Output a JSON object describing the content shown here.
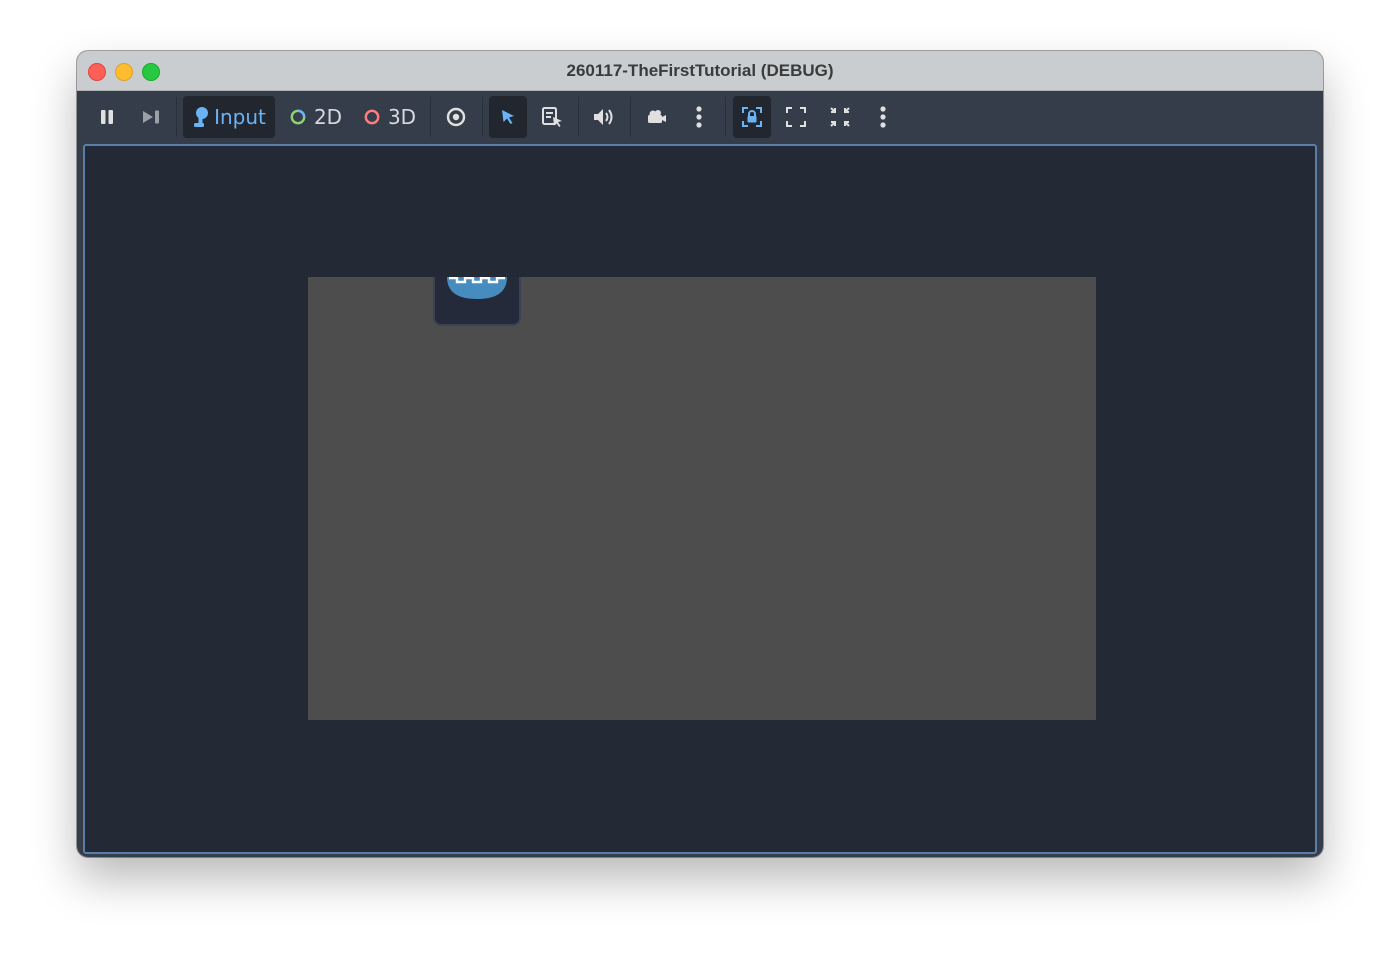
{
  "window": {
    "title": "260117-TheFirstTutorial (DEBUG)"
  },
  "toolbar": {
    "pause_icon": "pause-icon",
    "next_frame_icon": "next-frame-icon",
    "input_label": "Input",
    "mode_2d_label": "2D",
    "mode_3d_label": "3D",
    "visibility_icon": "eye-icon",
    "select_icon": "pointer-select-icon",
    "list_select_icon": "list-select-icon",
    "audio_icon": "speaker-icon",
    "camera_icon": "camera-icon",
    "more_icon": "kebab-menu-icon",
    "camera_lock_icon": "camera-lock-icon",
    "expand_icon": "expand-icon",
    "collapse_icon": "collapse-icon",
    "more2_icon": "kebab-menu-icon"
  },
  "colors": {
    "accent_blue": "#6ab4f5",
    "active_bg": "#21262f",
    "viewport_border": "#5a7eaa",
    "game_bg": "#4d4d4d",
    "ring_2d": "#8fd36f",
    "ring_3d": "#ff7f7f"
  },
  "game": {
    "sprite": "godot-logo-sprite"
  }
}
